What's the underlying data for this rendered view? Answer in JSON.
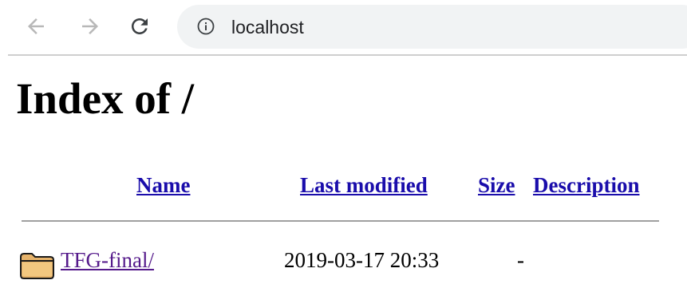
{
  "browser": {
    "url": "localhost",
    "icons": {
      "back": "arrow-left-icon",
      "forward": "arrow-right-icon",
      "reload": "reload-icon",
      "site_info": "info-icon"
    },
    "back_enabled": false,
    "forward_enabled": false
  },
  "page": {
    "heading": "Index of /",
    "columns": {
      "name": "Name",
      "last_modified": "Last modified",
      "size": "Size",
      "description": "Description"
    },
    "entries": [
      {
        "icon": "folder-icon",
        "name": "TFG-final/",
        "last_modified": "2019-03-17 20:33",
        "size": "-",
        "description": ""
      }
    ]
  },
  "colors": {
    "link": "#1a0dab",
    "visited_link": "#551a8b",
    "omnibox_bg": "#f1f3f4",
    "disabled_icon": "#b8b8b8"
  }
}
